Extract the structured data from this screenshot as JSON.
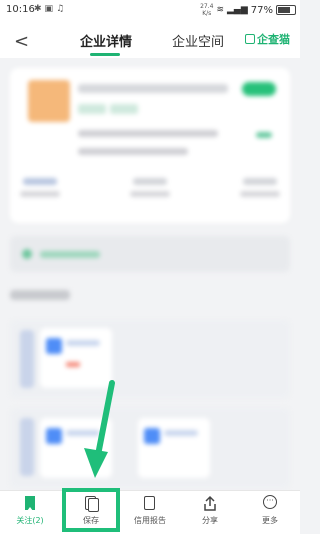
{
  "status_bar": {
    "time": "10:16",
    "net_speed_top": "27.4",
    "net_speed_bottom": "K/s",
    "battery": "77%"
  },
  "nav": {
    "tab_active": "企业详情",
    "tab_other": "企业空间",
    "brand": "企查猫"
  },
  "bottom_bar": {
    "follow": "关注(2)",
    "save": "保存",
    "credit_report": "信用报告",
    "share": "分享",
    "more": "更多"
  },
  "colors": {
    "accent": "#1fb373",
    "annotation_green": "#1fbe7a"
  }
}
